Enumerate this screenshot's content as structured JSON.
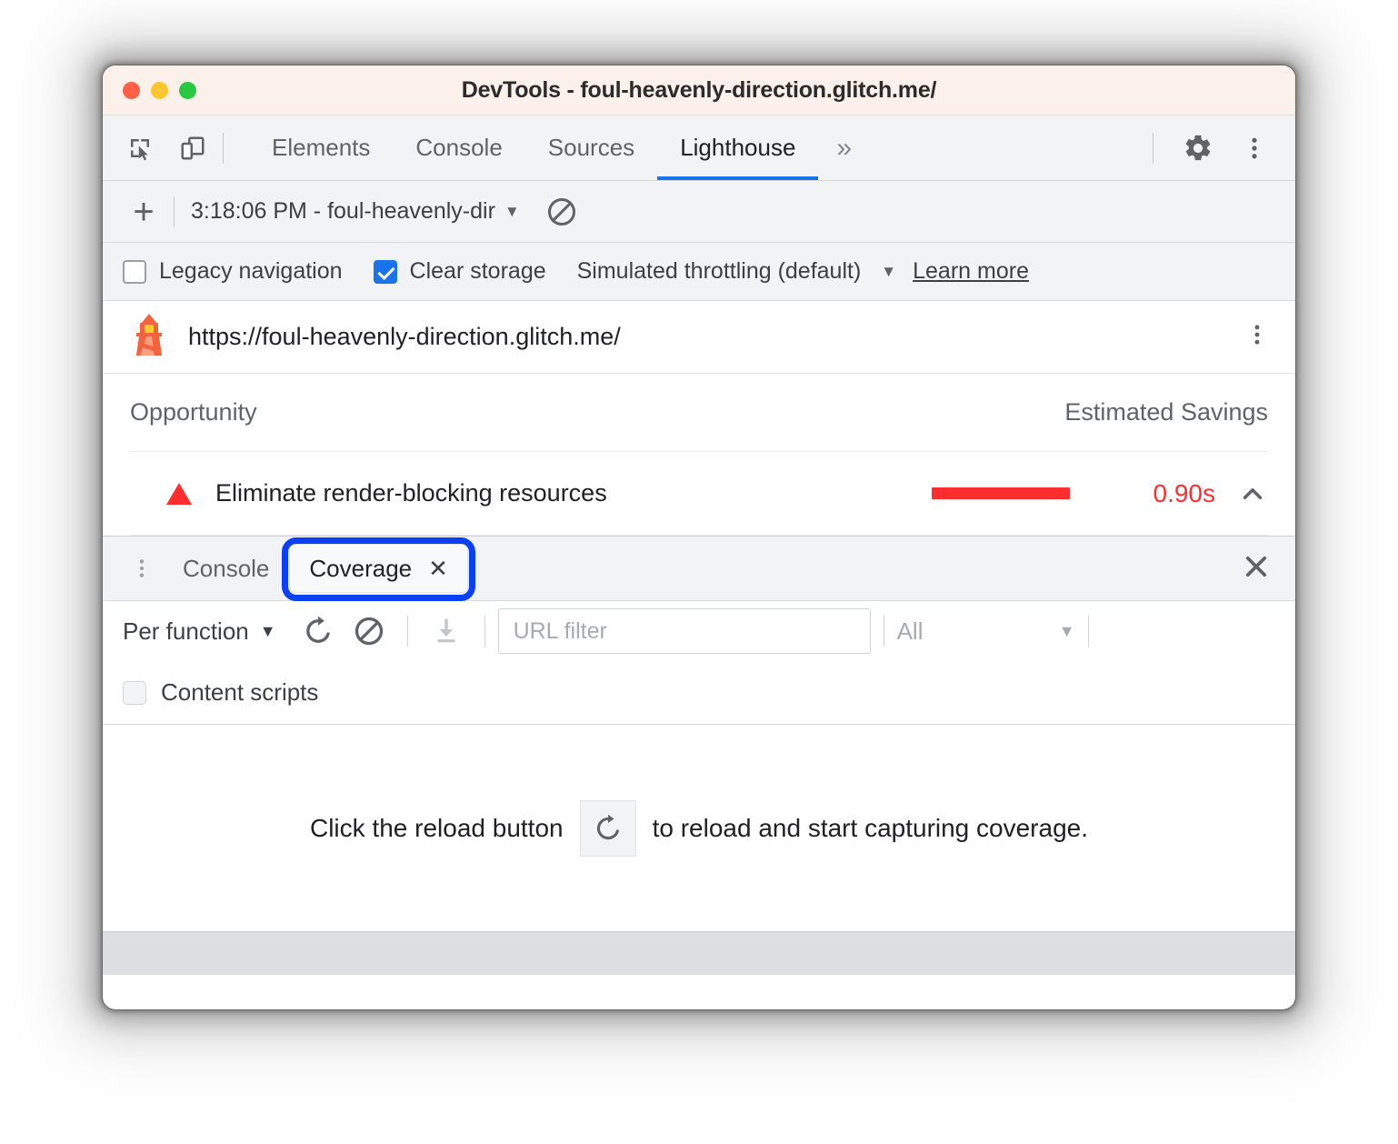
{
  "window": {
    "title": "DevTools - foul-heavenly-direction.glitch.me/",
    "traffic_lights": [
      "close",
      "minimize",
      "zoom"
    ],
    "colors": {
      "titlebar_bg": "#fbf1ea",
      "accent_blue": "#1a73e8",
      "annotation_blue": "#0b41f5",
      "alert_red": "#ff2d2d"
    }
  },
  "main_toolbar": {
    "icons": [
      {
        "name": "inspect-element-icon",
        "label": "Inspect element"
      },
      {
        "name": "device-toolbar-icon",
        "label": "Toggle device toolbar"
      }
    ],
    "tabs": [
      {
        "label": "Elements",
        "active": false
      },
      {
        "label": "Console",
        "active": false
      },
      {
        "label": "Sources",
        "active": false
      },
      {
        "label": "Lighthouse",
        "active": true
      }
    ],
    "more_tabs": "»",
    "right_icons": [
      {
        "name": "settings-gear-icon",
        "label": "Settings"
      },
      {
        "name": "main-menu-icon",
        "label": "Customize and control DevTools"
      }
    ]
  },
  "run_bar": {
    "add_label": "+",
    "selected_run": "3:18:06 PM - foul-heavenly-dir",
    "caret": "▼",
    "clear_label": "Clear all"
  },
  "options_bar": {
    "legacy_navigation": {
      "label": "Legacy navigation",
      "checked": false
    },
    "clear_storage": {
      "label": "Clear storage",
      "checked": true
    },
    "throttling": {
      "label": "Simulated throttling (default)",
      "caret": "▼"
    },
    "learn_more": "Learn more"
  },
  "report": {
    "site_url": "https://foul-heavenly-direction.glitch.me/",
    "lighthouse_icon": "lighthouse-icon",
    "menu_icon": "report-menu-icon",
    "columns": {
      "opportunity": "Opportunity",
      "estimated_savings": "Estimated Savings"
    },
    "rows": [
      {
        "severity": "error",
        "title": "Eliminate render-blocking resources",
        "savings": "0.90s",
        "bar_color": "#ff2d2d",
        "expanded": true,
        "chevron": "chevron-up-icon"
      }
    ]
  },
  "drawer": {
    "menu_icon": "drawer-menu-icon",
    "tabs": [
      {
        "label": "Console",
        "active": false,
        "closeable": false
      },
      {
        "label": "Coverage",
        "active": true,
        "closeable": true,
        "close_glyph": "✕",
        "highlighted": true
      }
    ],
    "close_glyph": "✕"
  },
  "coverage": {
    "mode_dropdown": {
      "value": "Per function",
      "caret": "▼"
    },
    "toolbar_icons": [
      {
        "name": "reload-icon",
        "label": "Start instrumenting coverage and reload page",
        "disabled": false
      },
      {
        "name": "clear-icon",
        "label": "Clear all",
        "disabled": false
      },
      {
        "name": "export-icon",
        "label": "Export",
        "disabled": true
      }
    ],
    "url_filter": {
      "placeholder": "URL filter",
      "value": ""
    },
    "type_dropdown": {
      "value": "All",
      "caret": "▼"
    },
    "content_scripts": {
      "label": "Content scripts",
      "checked": false
    },
    "empty_state": {
      "text_before": "Click the reload button",
      "button_icon": "reload-icon",
      "text_after": "to reload and start capturing coverage."
    }
  }
}
